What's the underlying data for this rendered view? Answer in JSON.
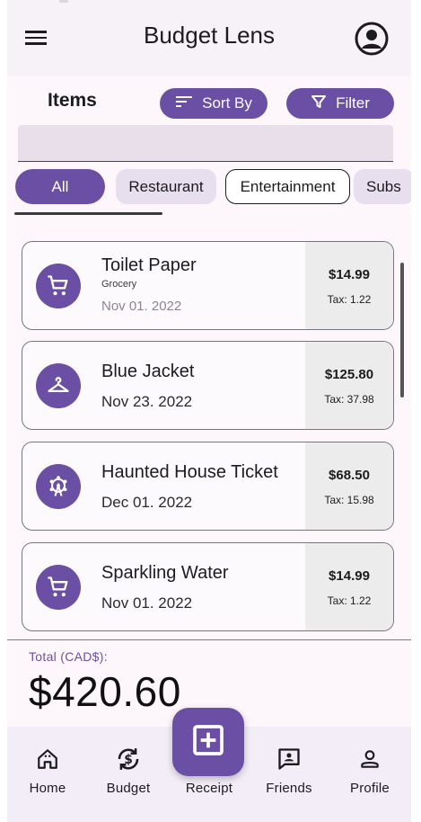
{
  "app": {
    "title": "Budget Lens"
  },
  "header": {
    "menu_icon": "menu-icon",
    "account_icon": "account-circle-icon"
  },
  "items_section": {
    "title": "Items",
    "sort_label": "Sort By",
    "filter_label": "Filter",
    "search_value": "",
    "search_placeholder": ""
  },
  "chips": [
    {
      "label": "All",
      "selected": true
    },
    {
      "label": "Restaurant",
      "selected": false
    },
    {
      "label": "Entertainment",
      "selected": false
    },
    {
      "label": "Subs",
      "selected": false
    }
  ],
  "items": [
    {
      "name": "Toilet Paper",
      "category": "Grocery",
      "date": "Nov 01. 2022",
      "price": "$14.99",
      "tax": "Tax: 1.22",
      "icon": "shopping-cart-icon"
    },
    {
      "name": "Blue Jacket",
      "category": "",
      "date": "Nov 23. 2022",
      "price": "$125.80",
      "tax": "Tax: 37.98",
      "icon": "hanger-icon"
    },
    {
      "name": "Haunted House Ticket",
      "category": "",
      "date": "Dec 01. 2022",
      "price": "$68.50",
      "tax": "Tax: 15.98",
      "icon": "ferris-wheel-icon"
    },
    {
      "name": "Sparkling Water",
      "category": "",
      "date": "Nov 01. 2022",
      "price": "$14.99",
      "tax": "Tax: 1.22",
      "icon": "shopping-cart-icon"
    }
  ],
  "total": {
    "label": "Total (CAD$):",
    "value": "$420.60"
  },
  "bottom_nav": [
    {
      "label": "Home",
      "icon": "home-icon"
    },
    {
      "label": "Budget",
      "icon": "budget-refresh-dollar-icon"
    },
    {
      "label": "Receipt",
      "icon": "add-box-icon"
    },
    {
      "label": "Friends",
      "icon": "chat-person-icon"
    },
    {
      "label": "Profile",
      "icon": "person-icon"
    }
  ],
  "colors": {
    "accent": "#6b4fa5",
    "chip_unselected": "#e8dfee",
    "surface": "#fdf7fc",
    "price_box": "#ececec"
  }
}
